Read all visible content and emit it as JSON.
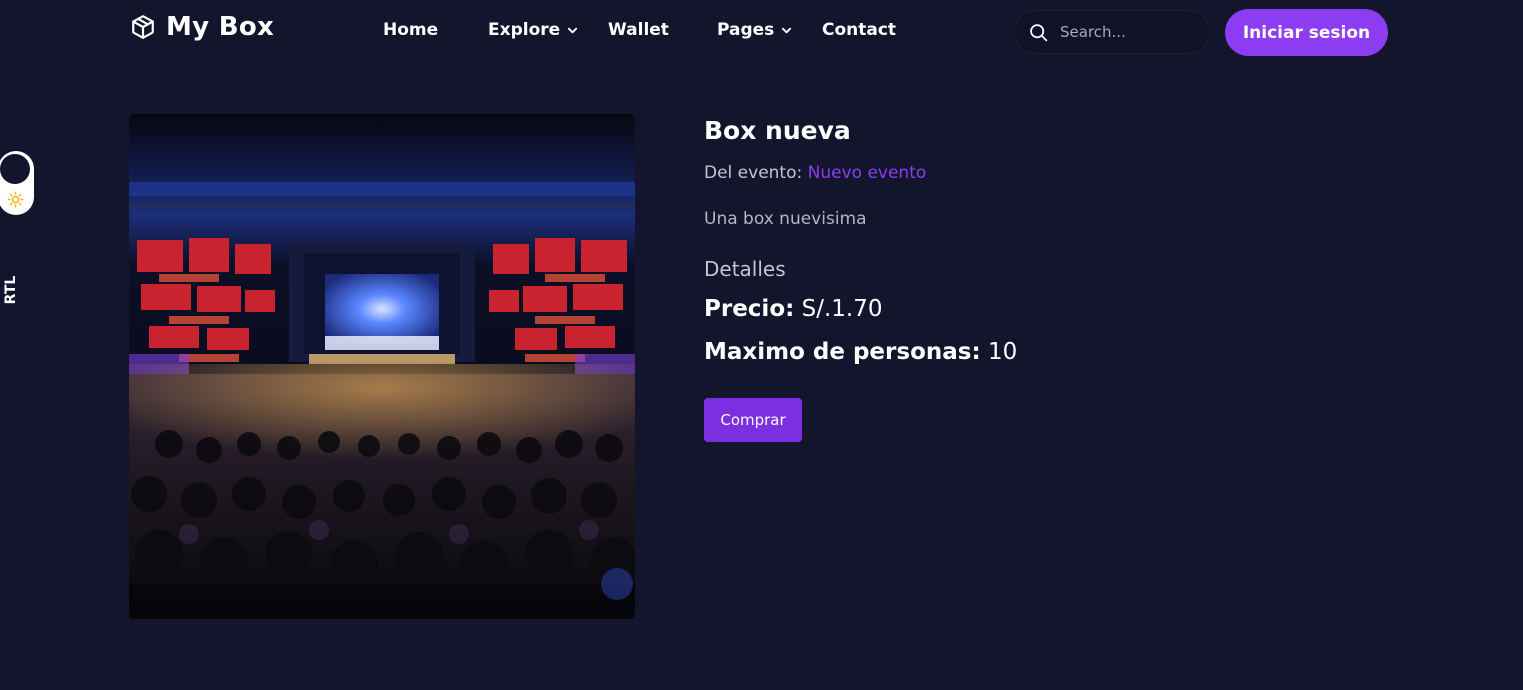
{
  "header": {
    "brand": "My Box",
    "nav": [
      {
        "label": "Home",
        "dropdown": false
      },
      {
        "label": "Explore",
        "dropdown": true
      },
      {
        "label": "Wallet",
        "dropdown": false
      },
      {
        "label": "Pages",
        "dropdown": true
      },
      {
        "label": "Contact",
        "dropdown": false
      }
    ],
    "search": {
      "placeholder": "Search..."
    },
    "login_label": "Iniciar sesion"
  },
  "sidebar": {
    "rtl_label": "RTL"
  },
  "product": {
    "title": "Box nueva",
    "event_prefix": "Del evento:",
    "event_name": "Nuevo evento",
    "description": "Una box nuevisima",
    "details_heading": "Detalles",
    "price_label": "Precio:",
    "price_value": "S/.1.70",
    "max_label": "Maximo de personas:",
    "max_value": "10",
    "buy_label": "Comprar"
  },
  "colors": {
    "background": "#12152b",
    "accent": "#8c3df2",
    "button": "#7b2fe0",
    "text": "#ffffff",
    "muted_text": "#c2c5d6"
  },
  "icons": {
    "logo": "cube-icon",
    "search": "search-icon",
    "dropdown": "chevron-down-icon",
    "theme": "sun-icon"
  }
}
